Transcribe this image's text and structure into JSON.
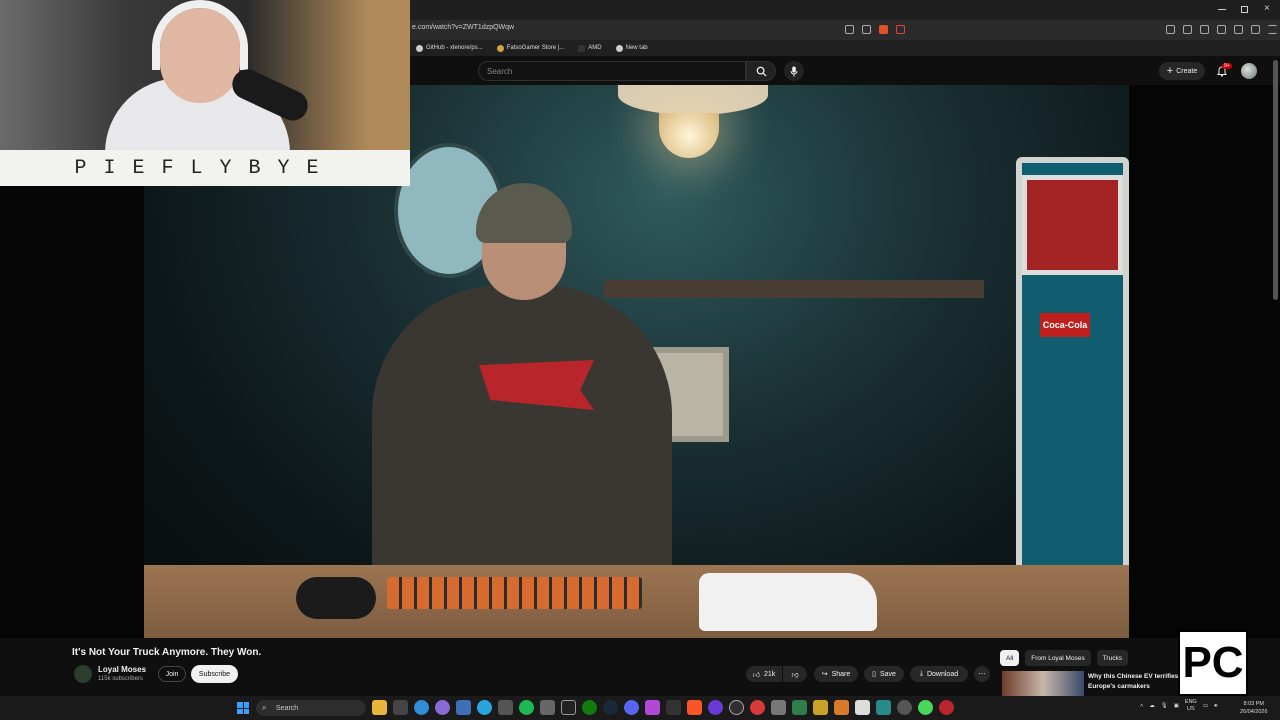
{
  "browser": {
    "url": "e.com/watch?v=ZWT1dzpQWqw",
    "bookmarks": [
      "GitHub - xlenore/ps...",
      "FatsoGamer Store |...",
      "AMD",
      "New tab"
    ]
  },
  "youtube": {
    "search_placeholder": "Search",
    "create_label": "Create",
    "notif_badge": "9+"
  },
  "overlay": {
    "banner_text": "PIEFLYBYE"
  },
  "video": {
    "title": "It's Not Your Truck Anymore. They Won.",
    "channel_name": "Loyal Moses",
    "subscribers": "115k subscribers",
    "join_label": "Join",
    "subscribe_label": "Subscribe",
    "likes": "21k",
    "share_label": "Share",
    "save_label": "Save",
    "download_label": "Download",
    "scene_text": "Coca-Cola"
  },
  "sidebar": {
    "chips": [
      "All",
      "From Loyal Moses",
      "Trucks"
    ],
    "recommendation_title": "Why this Chinese EV terrifies Europe's carmakers"
  },
  "logo_text": "PC",
  "taskbar": {
    "search_placeholder": "Search",
    "lang": "ENG",
    "region": "US",
    "time": "8:03 PM",
    "date": "26/04/2026"
  },
  "colors": {
    "background": "#0f0f0f",
    "subscribe_bg": "#f1f1f1",
    "badge": "#cc0000"
  }
}
